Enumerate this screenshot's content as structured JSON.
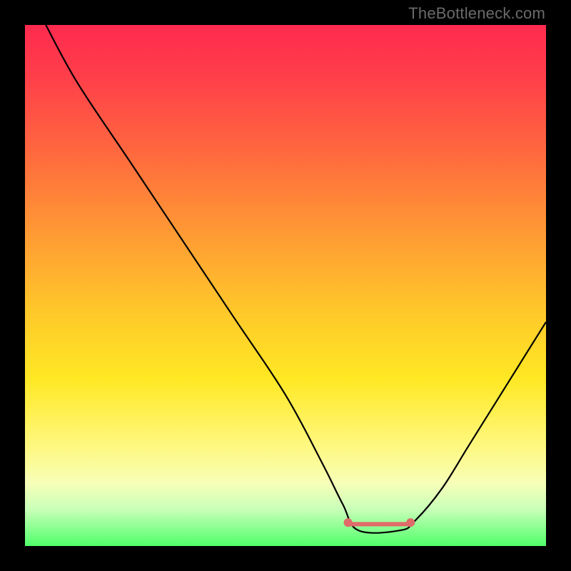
{
  "watermark": "TheBottleneck.com",
  "chart_data": {
    "type": "line",
    "title": "",
    "xlabel": "",
    "ylabel": "",
    "xlim": [
      0,
      100
    ],
    "ylim": [
      0,
      100
    ],
    "grid": false,
    "series": [
      {
        "name": "bottleneck-curve",
        "x": [
          4,
          10,
          20,
          30,
          40,
          50,
          57,
          61,
          64,
          72,
          75,
          80,
          85,
          90,
          95,
          100
        ],
        "y": [
          100,
          89,
          74,
          59,
          44,
          29,
          16,
          8,
          3,
          3,
          5,
          11,
          19,
          27,
          35,
          43
        ]
      }
    ],
    "markers": [
      {
        "name": "flat-left-dot",
        "x": 62,
        "y": 4.5,
        "color": "#e06a6a",
        "r": 6
      },
      {
        "name": "flat-right-dot",
        "x": 74,
        "y": 4.5,
        "color": "#e06a6a",
        "r": 6
      }
    ],
    "flat_segment": {
      "x1": 62,
      "x2": 74,
      "y": 4.2,
      "color": "#e06a6a",
      "width": 6
    },
    "curve_color": "#000000",
    "curve_width": 2.2
  }
}
